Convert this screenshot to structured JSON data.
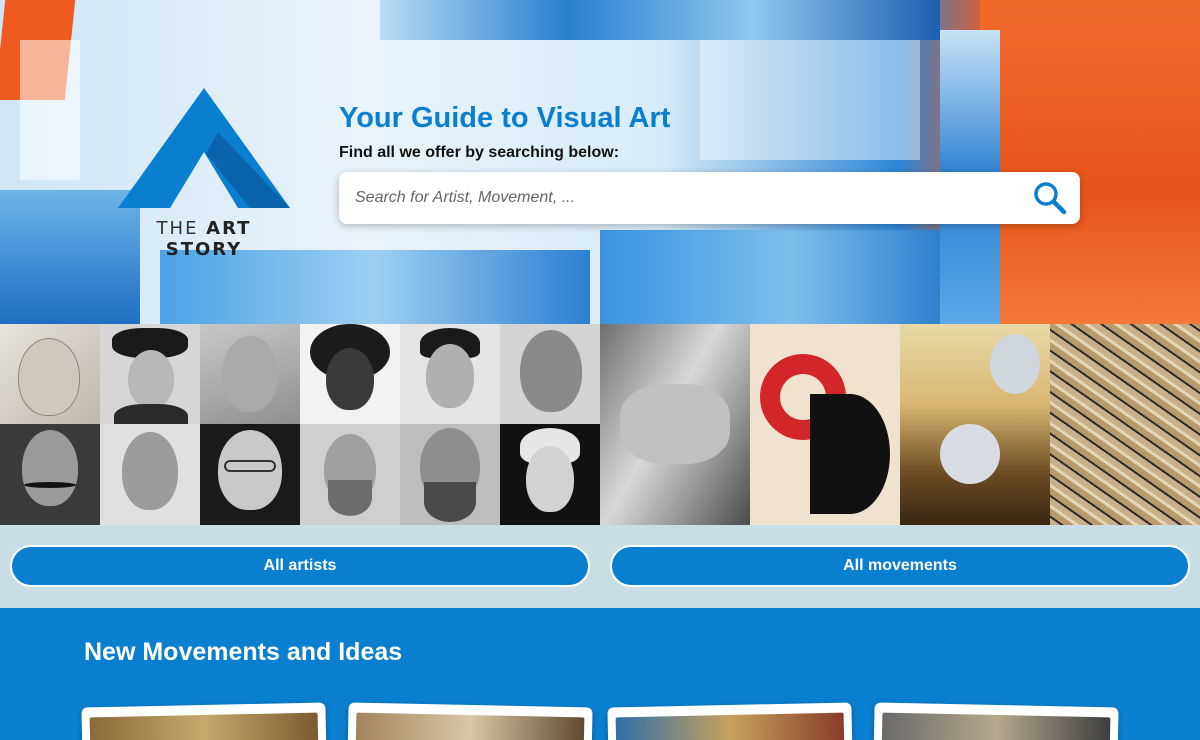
{
  "brand": {
    "logo_word_light": "THE ",
    "logo_word_bold": "ART STORY",
    "accent_color": "#0a7fd0"
  },
  "hero": {
    "title": "Your Guide to Visual Art",
    "subtitle": "Find all we offer by searching below:",
    "search_placeholder": "Search for Artist, Movement, ...",
    "search_icon": "search-icon"
  },
  "portraits": [
    "portrait-sketch-old-man",
    "portrait-woman-hat",
    "portrait-painted-man",
    "portrait-woman-natural-hair",
    "portrait-woman-braids",
    "portrait-bald-man",
    "portrait-man-mustache",
    "portrait-man-gray",
    "portrait-man-glasses",
    "portrait-man-beard-gray",
    "portrait-man-beard-dark",
    "portrait-woman-short-hair"
  ],
  "artworks": [
    "artwork-hands-sculpture",
    "artwork-bauhaus-poster",
    "artwork-melting-clocks",
    "artwork-drip-painting"
  ],
  "buttons": {
    "artists": "All artists",
    "movements": "All movements"
  },
  "section": {
    "title": "New Movements and Ideas",
    "cards": [
      "card-1",
      "card-2",
      "card-3",
      "card-4"
    ]
  }
}
